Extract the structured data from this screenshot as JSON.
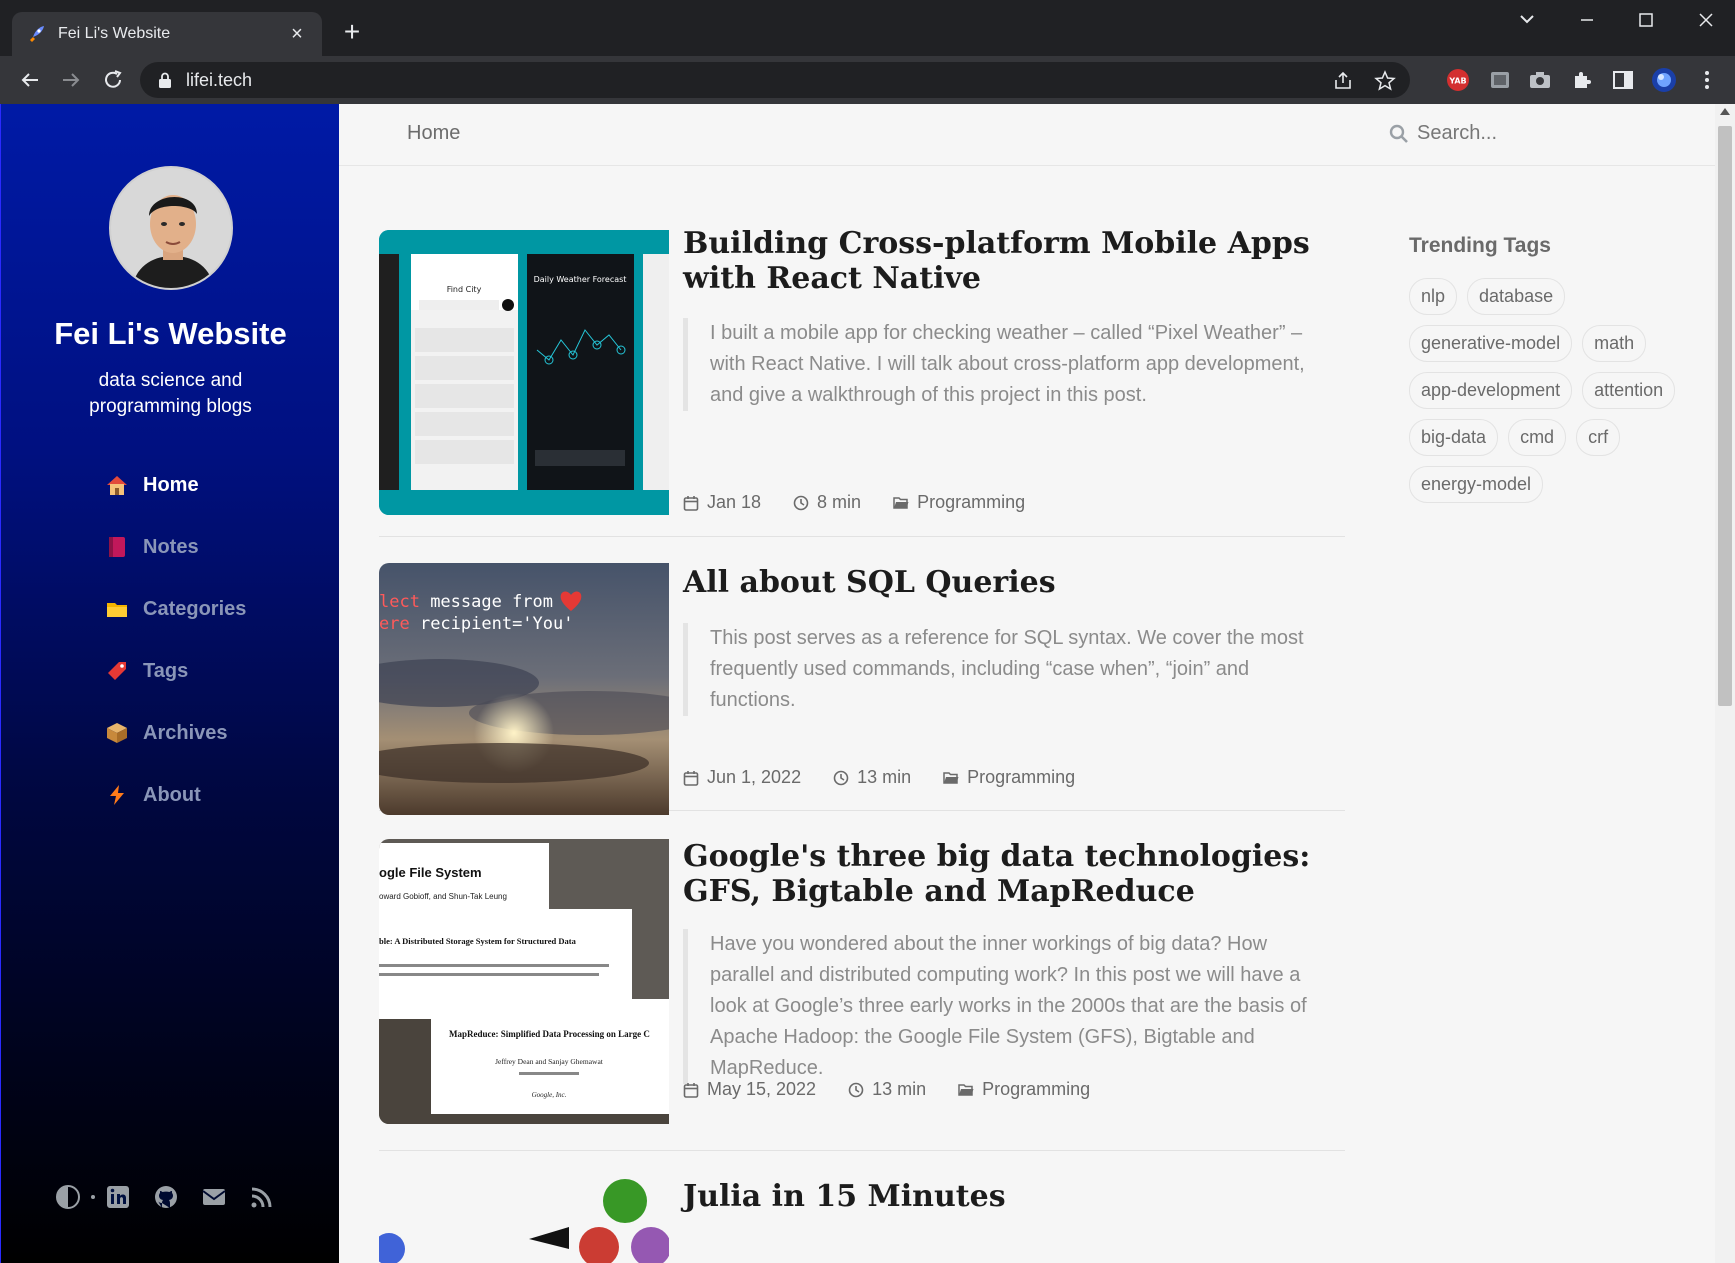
{
  "browser": {
    "tab_title": "Fei Li's Website",
    "url": "lifei.tech",
    "new_tab": "+",
    "close_tab": "×"
  },
  "sidebar": {
    "site_title": "Fei Li's Website",
    "subtitle": "data science and programming blogs",
    "nav": [
      {
        "label": "Home",
        "icon": "home-icon",
        "active": true
      },
      {
        "label": "Notes",
        "icon": "notebook-icon"
      },
      {
        "label": "Categories",
        "icon": "folder-icon"
      },
      {
        "label": "Tags",
        "icon": "tag-icon"
      },
      {
        "label": "Archives",
        "icon": "archive-box-icon"
      },
      {
        "label": "About",
        "icon": "lightning-icon"
      }
    ],
    "footer_icons": [
      "theme-toggle-icon",
      "linkedin-icon",
      "github-icon",
      "email-icon",
      "rss-icon"
    ]
  },
  "topbar": {
    "breadcrumb": "Home",
    "search_placeholder": "Search..."
  },
  "posts": [
    {
      "title": "Building Cross-platform Mobile Apps with React Native",
      "excerpt": "I built a mobile app for checking weather – called “Pixel Weather” – with React Native. I will talk about cross-platform app development, and give a walkthrough of this project in this post.",
      "date": "Jan 18",
      "read_time": "8 min",
      "category": "Programming"
    },
    {
      "title": "All about SQL Queries",
      "excerpt": "This post serves as a reference for SQL syntax. We cover the most frequently used commands, including “case when”, “join” and functions.",
      "date": "Jun 1, 2022",
      "read_time": "13 min",
      "category": "Programming"
    },
    {
      "title": "Google's three big data technologies: GFS, Bigtable and MapReduce",
      "excerpt": "Have you wondered about the inner workings of big data? How parallel and distributed computing work? In this post we will have a look at Google’s three early works in the 2000s that are the basis of Apache Hadoop: the Google File System (GFS), Bigtable and MapReduce.",
      "date": "May 15, 2022",
      "read_time": "13 min",
      "category": "Programming"
    },
    {
      "title": "Julia in 15 Minutes"
    }
  ],
  "thumb_text": {
    "weather_find_city": "Find City",
    "weather_forecast": "Daily Weather Forecast",
    "sql_line1_kw": "lect",
    "sql_line1_rest": " message from",
    "sql_line2_kw": "ere",
    "sql_line2_rest": " recipient='You'",
    "paper1": "ogle File System",
    "paper1_authors": "oward Gobioff, and Shun-Tak Leung",
    "paper2": "ble: A Distributed Storage System for Structured Data",
    "paper3": "MapReduce: Simplified Data Processing on Large C",
    "paper3_authors": "Jeffrey Dean and Sanjay Ghemawat",
    "paper3_org": "Google, Inc."
  },
  "trending": {
    "title": "Trending Tags",
    "tags": [
      "nlp",
      "database",
      "generative-model",
      "math",
      "app-development",
      "attention",
      "big-data",
      "cmd",
      "crf",
      "energy-model"
    ]
  },
  "colors": {
    "sidebar_top": "#001aa6",
    "sidebar_bottom": "#000000",
    "page_bg": "#f6f6f6"
  }
}
